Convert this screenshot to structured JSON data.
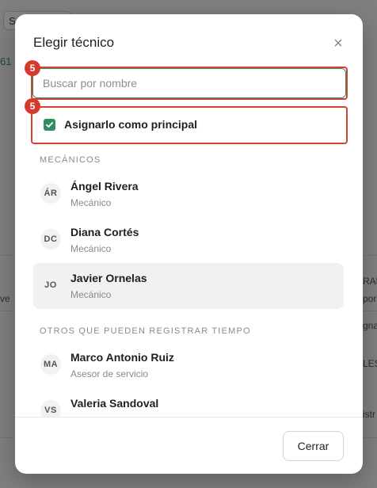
{
  "background": {
    "chip_label": "S",
    "left_number": "61",
    "left_text_1": "ve",
    "right_text_1": "RAB",
    "right_text_2": "por",
    "right_text_3": "gna",
    "right_text_4": "LES",
    "right_text_5": "istr"
  },
  "modal": {
    "title": "Elegir técnico",
    "close_symbol": "×",
    "search_placeholder": "Buscar por nombre",
    "step_badge_1": "5",
    "step_badge_2": "5",
    "principal_checkbox": {
      "label": "Asignarlo como principal",
      "checked": true
    },
    "sections": [
      {
        "label": "MECÁNICOS",
        "technicians": [
          {
            "initials": "ÁR",
            "name": "Ángel Rivera",
            "role": "Mecánico",
            "selected": false
          },
          {
            "initials": "DC",
            "name": "Diana Cortés",
            "role": "Mecánico",
            "selected": false
          },
          {
            "initials": "JO",
            "name": "Javier Ornelas",
            "role": "Mecánico",
            "selected": true
          }
        ]
      },
      {
        "label": "OTROS QUE PUEDEN REGISTRAR TIEMPO",
        "technicians": [
          {
            "initials": "MA",
            "name": "Marco Antonio Ruiz",
            "role": "Asesor de servicio",
            "selected": false
          },
          {
            "initials": "VS",
            "name": "Valeria Sandoval",
            "role": "",
            "selected": false
          }
        ]
      }
    ],
    "footer_close_label": "Cerrar"
  },
  "colors": {
    "accent_green": "#2f8f62",
    "highlight_red": "#d24336",
    "badge_red": "#d63a2c"
  }
}
